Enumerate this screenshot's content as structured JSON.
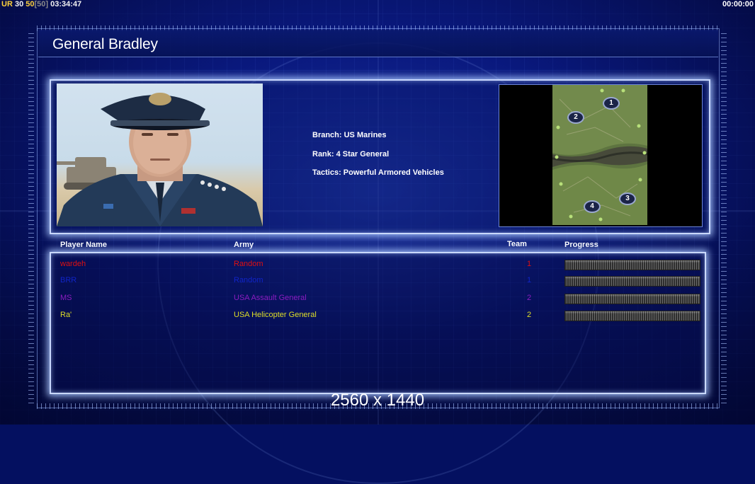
{
  "hud": {
    "ur_label": "UR",
    "ur_value": "30",
    "fps": "50",
    "fps_cap": "[50]",
    "clock": "03:34:47",
    "timer": "00:00:00"
  },
  "general": {
    "name": "General Bradley",
    "branch": "Branch: US Marines",
    "rank": "Rank: 4 Star General",
    "tactics": "Tactics: Powerful Armored Vehicles"
  },
  "players_table": {
    "headers": {
      "name": "Player Name",
      "army": "Army",
      "team": "Team",
      "progress": "Progress"
    },
    "rows": [
      {
        "name": "wardeh",
        "army": "Random",
        "team": "1",
        "color": "#e01010",
        "progress": 1.0
      },
      {
        "name": "BRR",
        "army": "Random",
        "team": "1",
        "color": "#1024c8",
        "progress": 1.0
      },
      {
        "name": "MS",
        "army": "USA Assault General",
        "team": "2",
        "color": "#8c1cc0",
        "progress": 1.0
      },
      {
        "name": "Ra'",
        "army": "USA Helicopter General",
        "team": "2",
        "color": "#dede28",
        "progress": 1.0
      }
    ]
  },
  "minimap": {
    "start_positions": [
      "1",
      "2",
      "3",
      "4"
    ]
  },
  "resolution": "2560 x 1440"
}
